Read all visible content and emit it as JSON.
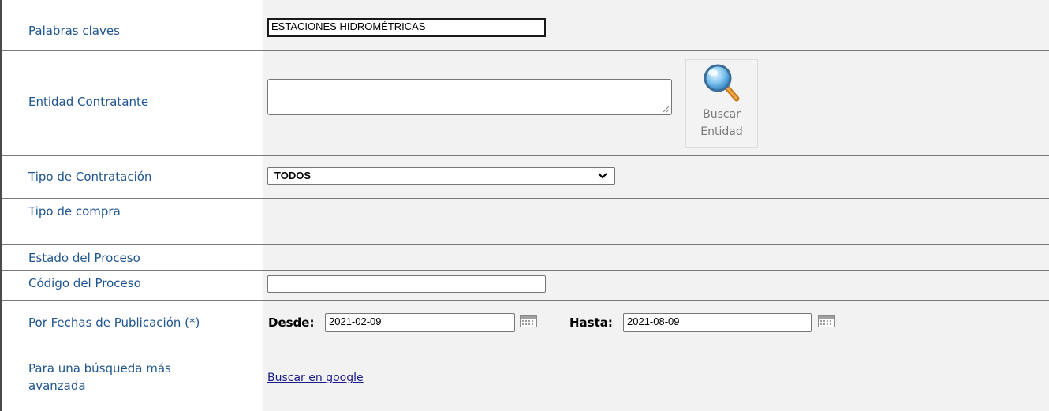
{
  "form": {
    "keywords": {
      "label": "Palabras claves",
      "value": "ESTACIONES HIDROMÉTRICAS"
    },
    "entity": {
      "label": "Entidad Contratante",
      "value": "",
      "search_button": {
        "line1": "Buscar",
        "line2": "Entidad",
        "icon": "magnifier-icon"
      }
    },
    "contract_type": {
      "label": "Tipo de Contratación",
      "selected": "TODOS"
    },
    "purchase_type": {
      "label": "Tipo de compra"
    },
    "process_state": {
      "label": "Estado del Proceso"
    },
    "process_code": {
      "label": "Código del Proceso",
      "value": ""
    },
    "publication_dates": {
      "label": "Por Fechas de Publicación (*)",
      "from_label": "Desde:",
      "from_value": "2021-02-09",
      "to_label": "Hasta:",
      "to_value": "2021-08-09",
      "icon": "calendar-icon"
    },
    "advanced": {
      "label_line1": "Para una búsqueda más",
      "label_line2": "avanzada",
      "link": "Buscar en google"
    }
  }
}
